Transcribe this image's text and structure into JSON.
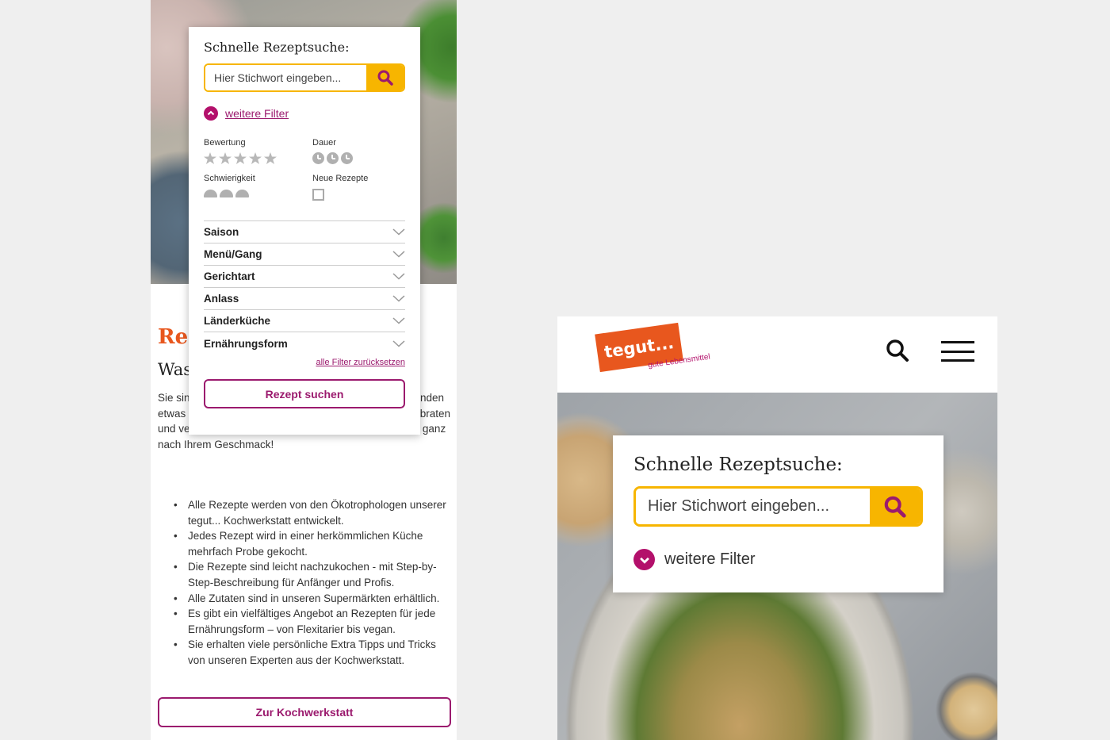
{
  "left": {
    "filter_panel": {
      "title": "Schnelle Rezeptsuche:",
      "search_placeholder": "Hier Stichwort eingeben...",
      "toggle_label": "weitere Filter",
      "filters": {
        "rating_label": "Bewertung",
        "duration_label": "Dauer",
        "difficulty_label": "Schwierigkeit",
        "new_recipes_label": "Neue Rezepte"
      },
      "categories": [
        "Saison",
        "Menü/Gang",
        "Gerichtart",
        "Anlass",
        "Länderküche",
        "Ernährungsform"
      ],
      "reset_label": "alle Filter zurücksetzen",
      "submit_label": "Rezept suchen"
    },
    "intro": {
      "heading_1": "Rez",
      "heading_2": "Was",
      "paragraph": "Sie sind auf der Suche nach ... unsere ... Rezepten ... finden etwas dabei: Vom raffinierten Vorspeisen über Festtagsbraten und vegane Küche bis zu himmlischen Desserts – alles ganz nach Ihrem Geschmack!"
    },
    "bullets": [
      "Alle Rezepte werden von den Ökotrophologen unserer tegut... Kochwerkstatt entwickelt.",
      "Jedes Rezept wird in einer herkömmlichen Küche mehrfach Probe gekocht.",
      "Die Rezepte sind leicht nachzukochen -  mit Step-by-Step-Beschreibung für Anfänger und Profis.",
      "Alle Zutaten sind in unseren Supermärkten erhältlich.",
      "Es gibt ein vielfältiges Angebot an Rezepten für jede Ernährungsform – von Flexitarier bis vegan.",
      "Sie erhalten viele persönliche Extra Tipps und Tricks von unseren Experten aus der Kochwerkstatt."
    ],
    "kochwerkstatt_button": "Zur Kochwerkstatt"
  },
  "right": {
    "logo_text": "tegut...",
    "logo_tagline": "gute Lebensmittel",
    "panel": {
      "title": "Schnelle Rezeptsuche:",
      "search_placeholder": "Hier Stichwort eingeben...",
      "toggle_label": "weitere Filter"
    }
  },
  "colors": {
    "brand_orange": "#e8571e",
    "accent_yellow": "#f7b500",
    "accent_magenta": "#9b1a6e"
  }
}
